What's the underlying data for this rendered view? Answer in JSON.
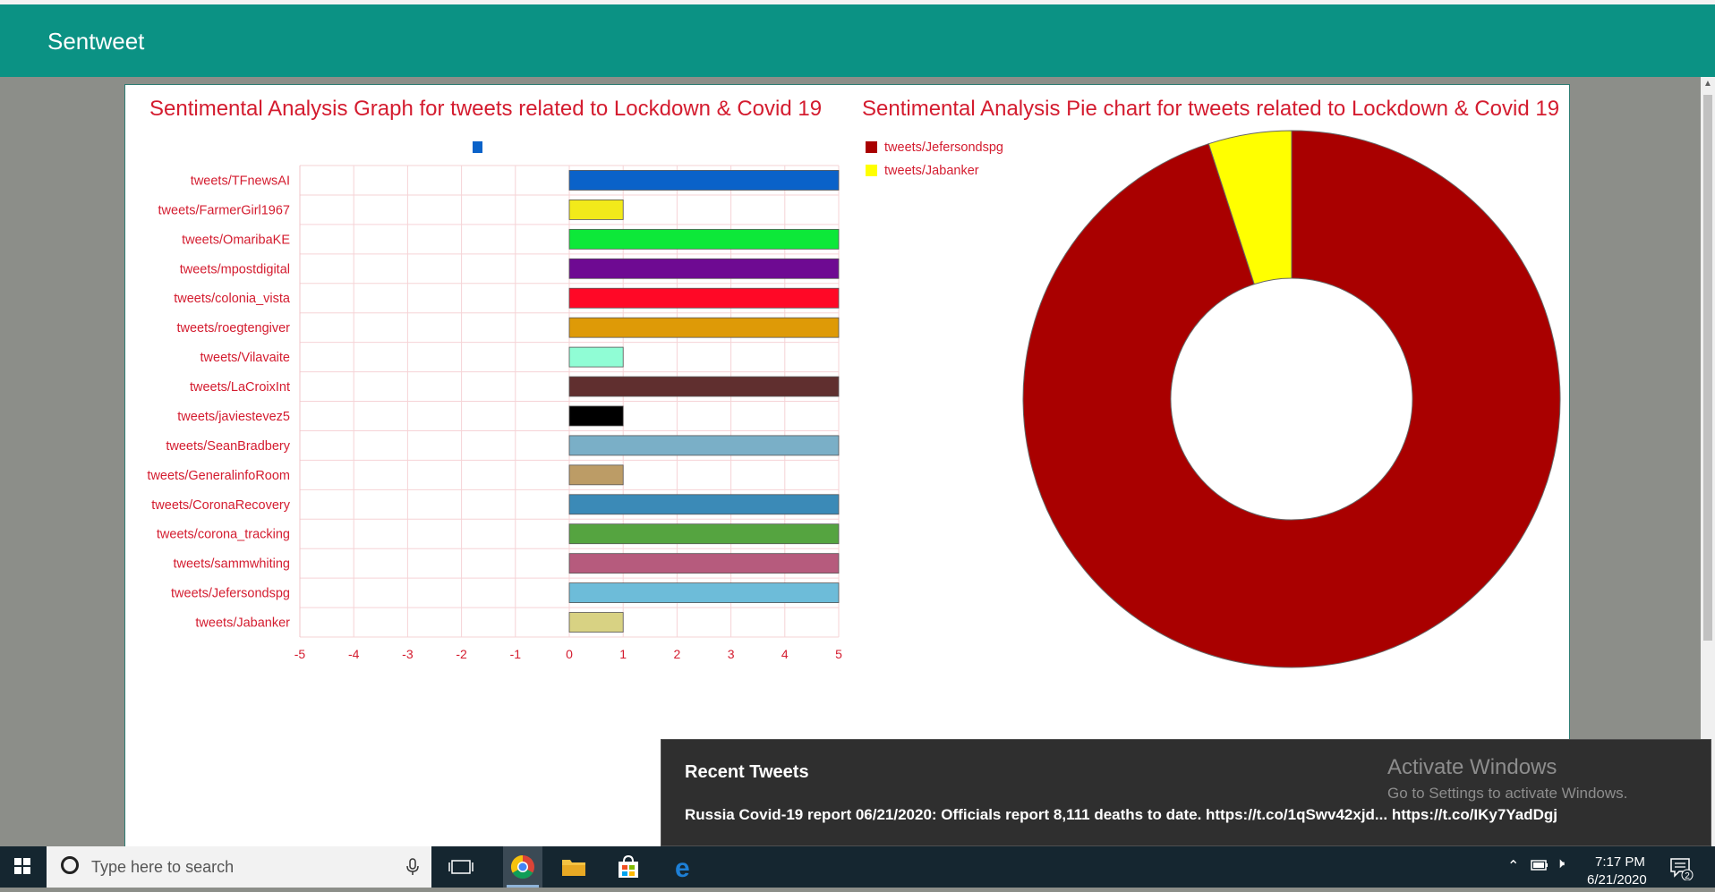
{
  "app": {
    "title": "Sentweet"
  },
  "bar_chart": {
    "title": "Sentimental Analysis Graph for tweets related to Lockdown & Covid 19"
  },
  "pie_chart": {
    "title": "Sentimental Analysis Pie chart for tweets related to Lockdown & Covid 19"
  },
  "chart_data": [
    {
      "type": "bar",
      "orientation": "horizontal",
      "title": "Sentimental Analysis Graph for tweets related to Lockdown & Covid 19",
      "categories": [
        "tweets/TFnewsAI",
        "tweets/FarmerGirl1967",
        "tweets/OmaribaKE",
        "tweets/mpostdigital",
        "tweets/colonia_vista",
        "tweets/roegtengiver",
        "tweets/Vilavaite",
        "tweets/LaCroixInt",
        "tweets/javiestevez5",
        "tweets/SeanBradbery",
        "tweets/GeneralinfoRoom",
        "tweets/CoronaRecovery",
        "tweets/corona_tracking",
        "tweets/sammwhiting",
        "tweets/Jefersondspg",
        "tweets/Jabanker"
      ],
      "values": [
        5,
        1,
        5,
        5,
        5,
        5,
        1,
        5,
        1,
        5,
        1,
        5,
        5,
        5,
        5,
        1
      ],
      "colors": [
        "#0a62c9",
        "#f2ea1a",
        "#0de839",
        "#6e0a92",
        "#ff0826",
        "#de9a07",
        "#90fdd5",
        "#602f2f",
        "#000000",
        "#7aafc7",
        "#bc9c66",
        "#3b8ab7",
        "#55a440",
        "#b65b7d",
        "#6dbcd9",
        "#d8d283"
      ],
      "xlim": [
        -5,
        5
      ],
      "xticks": [
        -5,
        -4,
        -3,
        -2,
        -1,
        0,
        1,
        2,
        3,
        4,
        5
      ],
      "legend_color": "#0a62c9",
      "grid": true
    },
    {
      "type": "pie",
      "variant": "doughnut",
      "title": "Sentimental Analysis Pie chart for tweets related to Lockdown & Covid 19",
      "labels": [
        "tweets/Jefersondspg",
        "tweets/Jabanker"
      ],
      "values": [
        95,
        5
      ],
      "colors": [
        "#a90000",
        "#ffff00"
      ],
      "legend_position": "top-left"
    }
  ],
  "recent_tweets": {
    "heading": "Recent Tweets",
    "items": [
      "Russia Covid-19 report 06/21/2020: Officials report 8,111 deaths to date. https://t.co/1qSwv42xjd... https://t.co/IKy7YadDgj"
    ]
  },
  "watermark": {
    "title": "Activate Windows",
    "subtitle": "Go to Settings to activate Windows."
  },
  "taskbar": {
    "search_placeholder": "Type here to search",
    "time": "7:17 PM",
    "date": "6/21/2020",
    "notification_count": "2",
    "icons": [
      "windows-start-icon",
      "search-icon",
      "microphone-icon",
      "task-view-icon",
      "chrome-icon",
      "file-explorer-icon",
      "store-icon",
      "edge-icon"
    ]
  }
}
